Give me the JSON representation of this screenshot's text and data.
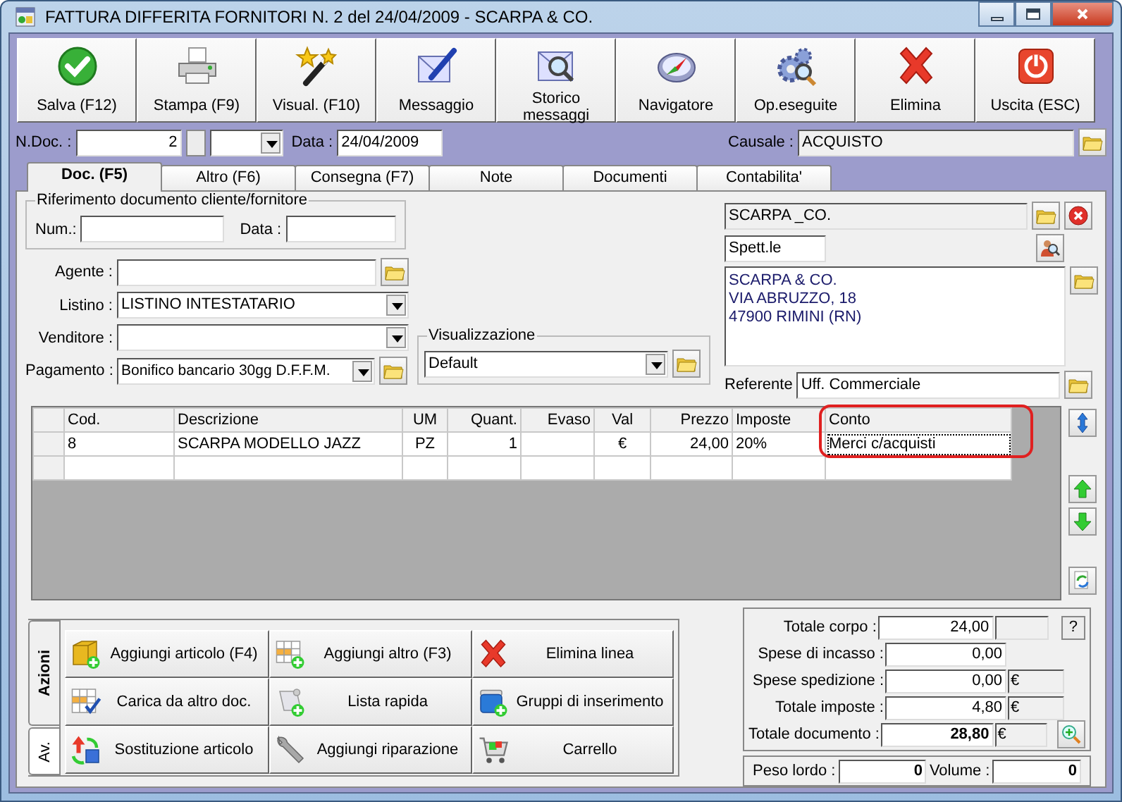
{
  "window": {
    "title": "FATTURA DIFFERITA FORNITORI N. 2  del 24/04/2009 - SCARPA & CO."
  },
  "toolbar": [
    {
      "label": "Salva (F12)",
      "kind": "check"
    },
    {
      "label": "Stampa (F9)",
      "kind": "printer"
    },
    {
      "label": "Visual. (F10)",
      "kind": "wand"
    },
    {
      "label": "Messaggio",
      "kind": "letter"
    },
    {
      "label": "Storico messaggi",
      "kind": "mailsearch"
    },
    {
      "label": "Navigatore",
      "kind": "compass"
    },
    {
      "label": "Op.eseguite",
      "kind": "gears"
    },
    {
      "label": "Elimina",
      "kind": "x"
    },
    {
      "label": "Uscita (ESC)",
      "kind": "power"
    }
  ],
  "header": {
    "ndoc_label": "N.Doc. :",
    "ndoc": "2",
    "data_label": "Data :",
    "data": "24/04/2009",
    "causale_label": "Causale :",
    "causale": "ACQUISTO"
  },
  "tabs": [
    {
      "label": "Doc. (F5)",
      "selected": true
    },
    {
      "label": "Altro (F6)",
      "selected": false
    },
    {
      "label": "Consegna (F7)",
      "selected": false
    },
    {
      "label": "Note",
      "selected": false
    },
    {
      "label": "Documenti",
      "selected": false
    },
    {
      "label": "Contabilita'",
      "selected": false
    }
  ],
  "riferimento": {
    "title": "Riferimento documento cliente/fornitore",
    "num_label": "Num.:",
    "data_label": "Data :"
  },
  "fields": [
    {
      "label": "Agente :",
      "kind": "lookup"
    },
    {
      "label": "Listino :",
      "kind": "select",
      "value": "LISTINO INTESTATARIO"
    },
    {
      "label": "Venditore :",
      "kind": "select"
    },
    {
      "label": "Pagamento :",
      "kind": "select-lookup",
      "value": "Bonifico bancario 30gg D.F.F.M."
    }
  ],
  "visualizzazione": {
    "title": "Visualizzazione",
    "value": "Default"
  },
  "intestatario": {
    "code": "SCARPA _CO.",
    "salutation": "Spett.le",
    "address": [
      "SCARPA & CO.",
      "VIA ABRUZZO, 18",
      "47900 RIMINI (RN)"
    ],
    "referente_label": "Referente",
    "referente": "Uff. Commerciale"
  },
  "table": {
    "columns": [
      {
        "label": "Cod.",
        "highlighted": false
      },
      {
        "label": "Descrizione",
        "highlighted": false
      },
      {
        "label": "UM",
        "highlighted": false
      },
      {
        "label": "Quant.",
        "highlighted": false
      },
      {
        "label": "Evaso",
        "highlighted": false
      },
      {
        "label": "Val",
        "highlighted": false
      },
      {
        "label": "Prezzo",
        "highlighted": false
      },
      {
        "label": "Imposte",
        "highlighted": false
      },
      {
        "label": "Conto",
        "highlighted": true
      }
    ],
    "rows": [
      {
        "cells": [
          "8",
          "SCARPA MODELLO JAZZ",
          "PZ",
          "1",
          "",
          "€",
          "24,00",
          "20%",
          "Merci c/acquisti"
        ]
      }
    ]
  },
  "actions": {
    "tabs": [
      {
        "label": "Azioni",
        "selected": true
      },
      {
        "label": "Av.",
        "selected": false
      }
    ],
    "buttons": [
      {
        "label": "Aggiungi articolo (F4)",
        "kind": "box-add"
      },
      {
        "label": "Aggiungi altro (F3)",
        "kind": "grid-add"
      },
      {
        "label": "Elimina linea",
        "kind": "x"
      },
      {
        "label": "Carica da altro doc.",
        "kind": "grid-check"
      },
      {
        "label": "Lista rapida",
        "kind": "scroll-add"
      },
      {
        "label": "Gruppi di inserimento",
        "kind": "bin-add"
      },
      {
        "label": "Sostituzione articolo",
        "kind": "arrows"
      },
      {
        "label": "Aggiungi riparazione",
        "kind": "wrench"
      },
      {
        "label": "Carrello",
        "kind": "cart"
      }
    ]
  },
  "totals": [
    {
      "label": "Totale corpo :",
      "value": "24,00",
      "kind": "help",
      "button": "?"
    },
    {
      "label": "Spese di incasso :",
      "value": "0,00",
      "kind": "plain"
    },
    {
      "label": "Spese spedizione :",
      "value": "0,00",
      "kind": "currency",
      "currency": "€"
    },
    {
      "label": "Totale imposte :",
      "value": "4,80",
      "kind": "currency",
      "currency": "€"
    },
    {
      "label": "Totale documento :",
      "value": "28,80",
      "kind": "total",
      "currency": "€"
    }
  ],
  "weights": [
    {
      "label": "Peso lordo :",
      "value": "0"
    },
    {
      "label": "Volume :",
      "value": "0"
    }
  ]
}
